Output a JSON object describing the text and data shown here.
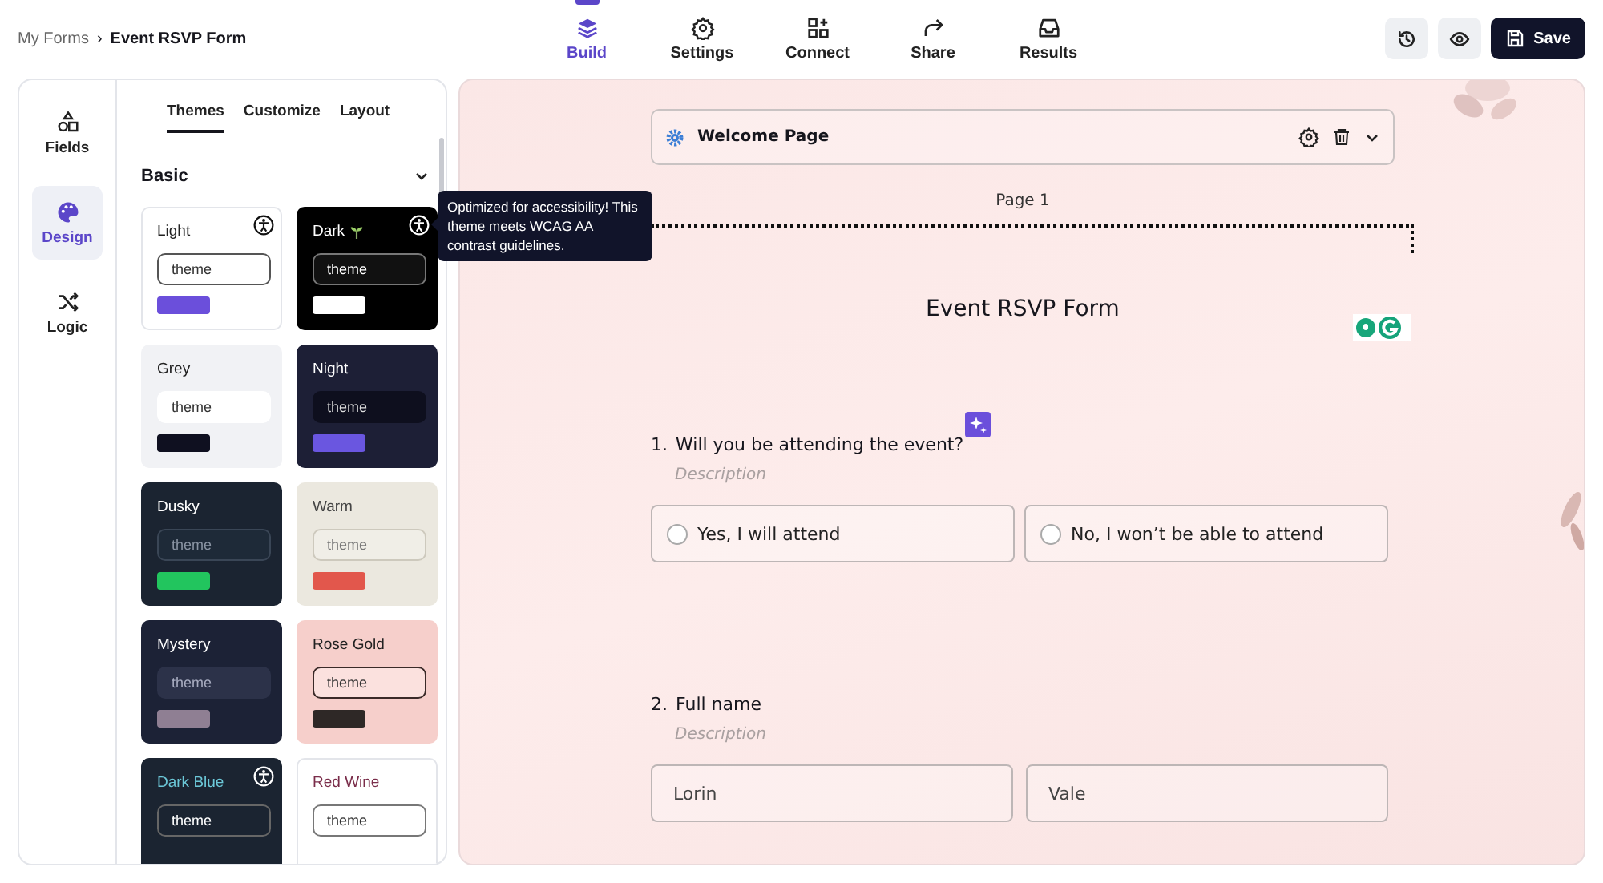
{
  "breadcrumb": {
    "parent": "My Forms",
    "separator": "›",
    "current": "Event RSVP Form"
  },
  "nav_tabs": [
    {
      "label": "Build",
      "selected": true
    },
    {
      "label": "Settings",
      "selected": false
    },
    {
      "label": "Connect",
      "selected": false
    },
    {
      "label": "Share",
      "selected": false
    },
    {
      "label": "Results",
      "selected": false
    }
  ],
  "save_label": "Save",
  "rail": [
    {
      "label": "Fields",
      "selected": false
    },
    {
      "label": "Design",
      "selected": true
    },
    {
      "label": "Logic",
      "selected": false
    }
  ],
  "panel_tabs": [
    {
      "label": "Themes",
      "selected": true
    },
    {
      "label": "Customize",
      "selected": false
    },
    {
      "label": "Layout",
      "selected": false
    }
  ],
  "section": {
    "title": "Basic",
    "expanded": true
  },
  "themes": [
    {
      "name": "Light",
      "kind": "light",
      "accessible": true,
      "field": "theme"
    },
    {
      "name": "Dark",
      "kind": "dark",
      "accessible": true,
      "field": "theme"
    },
    {
      "name": "Grey",
      "kind": "grey",
      "accessible": false,
      "field": "theme"
    },
    {
      "name": "Night",
      "kind": "night",
      "accessible": false,
      "field": "theme"
    },
    {
      "name": "Dusky",
      "kind": "dusky",
      "accessible": false,
      "field": "theme"
    },
    {
      "name": "Warm",
      "kind": "warm",
      "accessible": false,
      "field": "theme"
    },
    {
      "name": "Mystery",
      "kind": "mystery",
      "accessible": false,
      "field": "theme"
    },
    {
      "name": "Rose Gold",
      "kind": "rose",
      "accessible": false,
      "field": "theme"
    },
    {
      "name": "Dark Blue",
      "kind": "darkblue",
      "accessible": true,
      "field": "theme"
    },
    {
      "name": "Red Wine",
      "kind": "redwine",
      "accessible": false,
      "field": "theme"
    }
  ],
  "tooltip": "Optimized for accessibility! This theme meets WCAG AA contrast guidelines.",
  "canvas": {
    "welcome": {
      "title": "Welcome Page",
      "expanded": false
    },
    "page_label": "Page 1",
    "form_title": "Event RSVP Form",
    "questions": [
      {
        "kind": "choice",
        "number": "1.",
        "title": "Will you be attending the event?",
        "description": "Description",
        "options": [
          {
            "label": "Yes, I will attend",
            "selected": false
          },
          {
            "label": "No, I won’t be able to attend",
            "selected": false
          }
        ]
      },
      {
        "kind": "name",
        "number": "2.",
        "title": "Full name",
        "description": "Description",
        "fields": [
          {
            "value": "Lorin"
          },
          {
            "value": "Vale"
          }
        ]
      }
    ]
  }
}
